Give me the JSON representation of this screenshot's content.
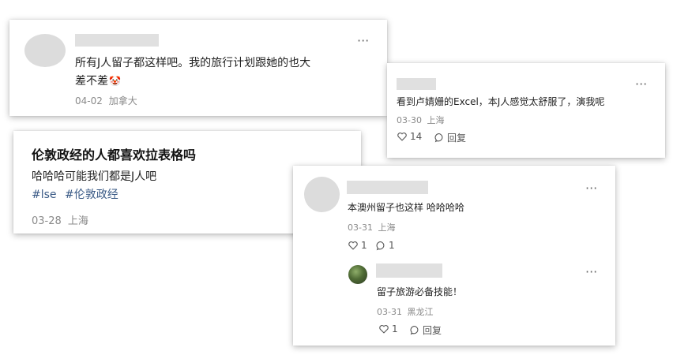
{
  "comments": [
    {
      "more": "···",
      "text_line1": "所有J人留子都这样吧。我的旅行计划跟她的也大",
      "text_line2": "差不差",
      "emoji": "🤡",
      "date": "04-02",
      "location": "加拿大"
    },
    {
      "more": "···",
      "text": "看到卢婧姗的Excel，本J人感觉太舒服了，演我呢",
      "date": "03-30",
      "location": "上海",
      "likes": "14",
      "reply_label": "回复"
    },
    {
      "title": "伦敦政经的人都喜欢拉表格吗",
      "text": "哈哈哈可能我们都是J人吧",
      "tags": [
        "#lse",
        "#伦敦政经"
      ],
      "date": "03-28",
      "location": "上海"
    },
    {
      "more": "···",
      "text": "本澳州留子也这样 哈哈哈哈",
      "date": "03-31",
      "location": "上海",
      "likes": "1",
      "comments": "1",
      "reply": {
        "more": "···",
        "text": "留子旅游必备技能！",
        "date": "03-31",
        "location": "黑龙江",
        "likes": "1",
        "reply_label": "回复"
      }
    }
  ]
}
